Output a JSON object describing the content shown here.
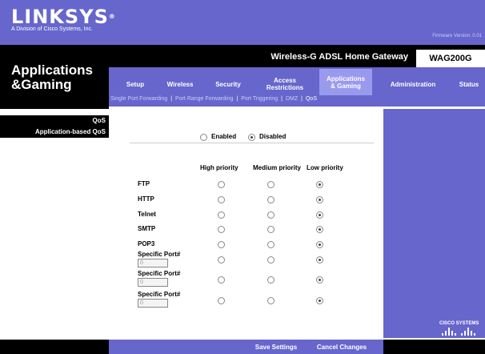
{
  "brand": {
    "logo": "LINKSYS",
    "registered": "®",
    "tagline": "A Division of Cisco Systems, Inc.",
    "firmware": "Firmware Version: 0.01"
  },
  "page_title": {
    "line1": "Applications",
    "line2": "&Gaming"
  },
  "product": {
    "name": "Wireless-G ADSL Home Gateway",
    "model": "WAG200G"
  },
  "tabs": [
    {
      "label": "Setup"
    },
    {
      "label": "Wireless"
    },
    {
      "label": "Security"
    },
    {
      "label1": "Access",
      "label2": "Restrictions"
    },
    {
      "label1": "Applications",
      "label2": "& Gaming",
      "active": true
    },
    {
      "label": "Administration"
    },
    {
      "label": "Status"
    }
  ],
  "subnav": [
    "Single Port Forwarding",
    "Port Range Forwarding",
    "Port Triggering",
    "DMZ",
    "QoS"
  ],
  "subnav_sep": "|",
  "sidebar": {
    "qos": "QoS",
    "app_qos": "Application-based QoS"
  },
  "qos_mode": {
    "enabled": "Enabled",
    "disabled": "Disabled",
    "selected": "disabled"
  },
  "columns": [
    "High priority",
    "Medium priority",
    "Low priority"
  ],
  "rows": [
    {
      "label": "FTP",
      "priority": "low"
    },
    {
      "label": "HTTP",
      "priority": "low"
    },
    {
      "label": "Telnet",
      "priority": "low"
    },
    {
      "label": "SMTP",
      "priority": "low"
    },
    {
      "label": "POP3",
      "priority": "low"
    },
    {
      "label": "Specific Port#",
      "value": "0",
      "priority": "low"
    },
    {
      "label": "Specific Port#",
      "value": "0",
      "priority": "low"
    },
    {
      "label": "Specific Port#",
      "value": "0",
      "priority": "low"
    }
  ],
  "buttons": {
    "save": "Save Settings",
    "cancel": "Cancel Changes"
  },
  "cisco": "CISCO SYSTEMS",
  "colors": {
    "header": "#6666cc",
    "active_tab": "#9999ee",
    "black": "#000000"
  }
}
